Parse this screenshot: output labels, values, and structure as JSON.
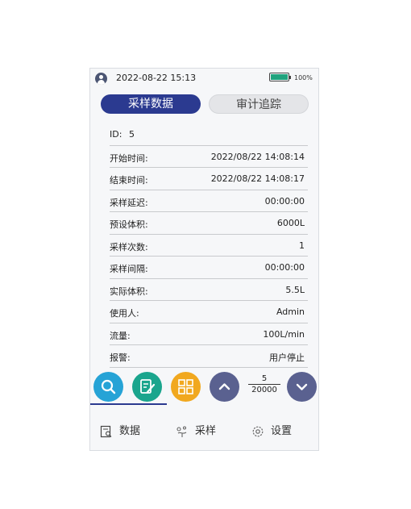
{
  "status": {
    "datetime": "2022-08-22 15:13",
    "battery": "100%",
    "battery_level": 1.0
  },
  "tabs": [
    {
      "label": "采样数据",
      "active": true
    },
    {
      "label": "审计追踪",
      "active": false
    }
  ],
  "record": {
    "id_label": "ID:",
    "id_value": "5",
    "rows": [
      {
        "label": "开始时间:",
        "value": "2022/08/22 14:08:14"
      },
      {
        "label": "结束时间:",
        "value": "2022/08/22 14:08:17"
      },
      {
        "label": "采样延迟:",
        "value": "00:00:00"
      },
      {
        "label": "预设体积:",
        "value": "6000L"
      },
      {
        "label": "采样次数:",
        "value": "1"
      },
      {
        "label": "采样间隔:",
        "value": "00:00:00"
      },
      {
        "label": "实际体积:",
        "value": "5.5L"
      },
      {
        "label": "使用人:",
        "value": "Admin"
      },
      {
        "label": "流量:",
        "value": "100L/min"
      },
      {
        "label": "报警:",
        "value": "用户停止"
      }
    ]
  },
  "pager": {
    "current": "5",
    "total": "20000"
  },
  "nav": [
    {
      "label": "数据"
    },
    {
      "label": "采样"
    },
    {
      "label": "设置"
    }
  ],
  "colors": {
    "accent": "#2b3a90",
    "search": "#26a3d6",
    "edit": "#1aa58d",
    "grid": "#f1a81f",
    "arrows": "#5a6190",
    "battery": "#21a37e"
  }
}
